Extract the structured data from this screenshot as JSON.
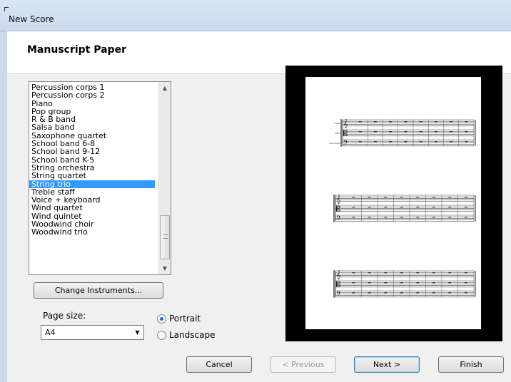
{
  "window": {
    "title": "New Score"
  },
  "page": {
    "title": "Manuscript Paper"
  },
  "instrument_list": {
    "items": [
      "Percussion corps 1",
      "Percussion corps 2",
      "Piano",
      "Pop group",
      "R & B band",
      "Salsa band",
      "Saxophone quartet",
      "School band 6-8",
      "School band 9-12",
      "School band K-5",
      "String orchestra",
      "String quartet",
      "String trio",
      "Treble staff",
      "Voice + keyboard",
      "Wind quartet",
      "Wind quintet",
      "Woodwind choir",
      "Woodwind trio"
    ],
    "selected": "String trio"
  },
  "change_instruments_label": "Change Instruments...",
  "page_size": {
    "label": "Page size:",
    "value": "A4"
  },
  "orientation": {
    "portrait": "Portrait",
    "landscape": "Landscape",
    "selected": "Portrait"
  },
  "buttons": {
    "cancel": "Cancel",
    "previous": "< Previous",
    "next": "Next >",
    "finish": "Finish"
  },
  "preview": {
    "instrument_names": [
      "Violin",
      "Viola",
      "Violoncello"
    ]
  },
  "icons": {
    "scroll_up": "scroll-up-arrow-icon",
    "scroll_down": "scroll-down-arrow-icon",
    "dropdown": "chevron-down-icon"
  },
  "colors": {
    "selection": "#3399ff",
    "titlebar": "#cad9eb"
  }
}
